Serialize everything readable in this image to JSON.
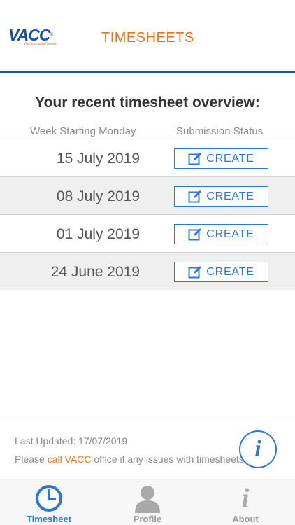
{
  "header": {
    "logo_text": "VACC",
    "logo_tagline": "You're in good hands",
    "title": "TIMESHEETS"
  },
  "overview": {
    "title": "Your recent timesheet overview:",
    "col_week": "Week Starting Monday",
    "col_status": "Submission Status"
  },
  "rows": [
    {
      "date": "15 July 2019",
      "action": "CREATE"
    },
    {
      "date": "08 July 2019",
      "action": "CREATE"
    },
    {
      "date": "01 July 2019",
      "action": "CREATE"
    },
    {
      "date": "24 June 2019",
      "action": "CREATE"
    }
  ],
  "footer": {
    "last_updated": "Last Updated: 17/07/2019",
    "please_prefix": "Please ",
    "call_link": "call VACC",
    "please_suffix": " office if any issues with timesheets"
  },
  "tabs": [
    {
      "label": "Timesheet",
      "icon": "clock-icon",
      "active": true
    },
    {
      "label": "Profile",
      "icon": "person-icon",
      "active": false
    },
    {
      "label": "About",
      "icon": "info-icon",
      "active": false
    }
  ],
  "colors": {
    "brand_blue": "#1e4fa8",
    "accent_orange": "#e8731f",
    "action_blue": "#2a78d6"
  }
}
